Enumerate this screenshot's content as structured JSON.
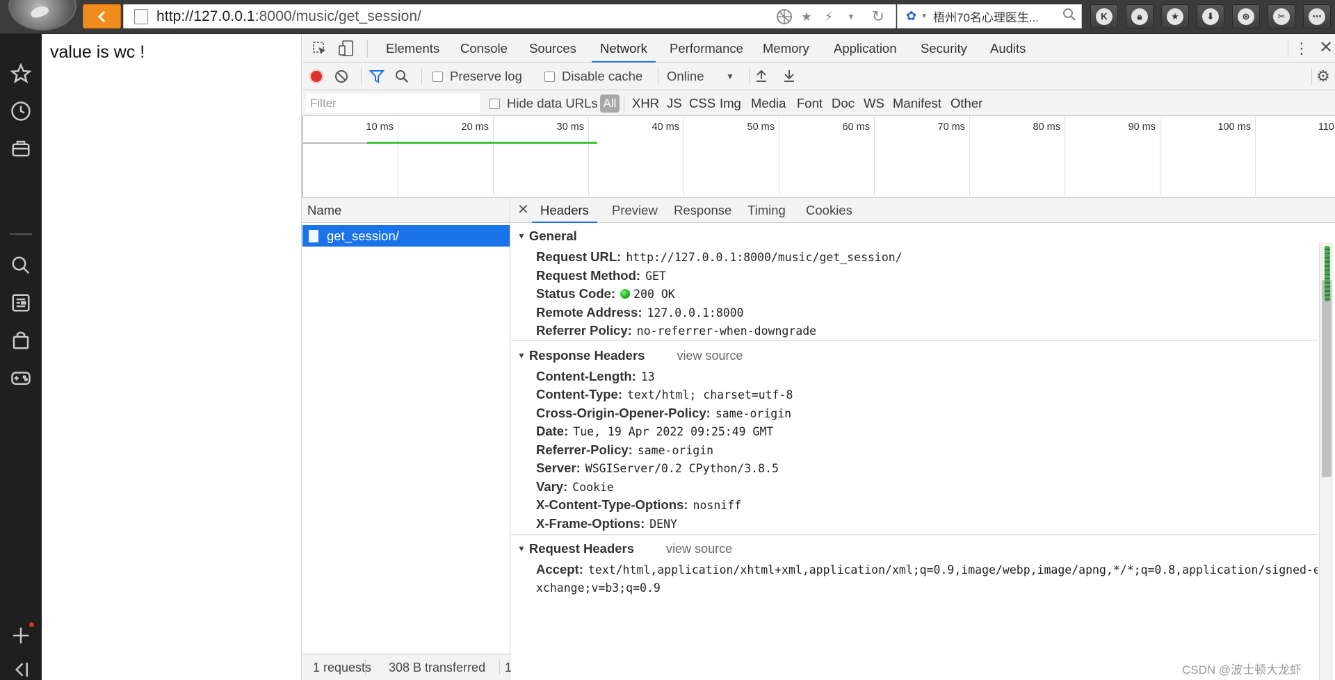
{
  "browser": {
    "url_host": "http://127.0.0.1",
    "url_rest": ":8000/music/get_session/",
    "search_text": "梧州70名心理医生...",
    "toolbar_letter": "K"
  },
  "page": {
    "text": "value is wc !"
  },
  "devtools": {
    "tabs": [
      "Elements",
      "Console",
      "Sources",
      "Network",
      "Performance",
      "Memory",
      "Application",
      "Security",
      "Audits"
    ],
    "active_tab": "Network",
    "toolbar": {
      "preserve_log": "Preserve log",
      "disable_cache": "Disable cache",
      "throttle": "Online"
    },
    "filter": {
      "placeholder": "Filter",
      "hide_data_urls": "Hide data URLs",
      "all": "All",
      "types": [
        "XHR",
        "JS",
        "CSS",
        "Img",
        "Media",
        "Font",
        "Doc",
        "WS",
        "Manifest",
        "Other"
      ]
    },
    "overview_ticks": [
      "10 ms",
      "20 ms",
      "30 ms",
      "40 ms",
      "50 ms",
      "60 ms",
      "70 ms",
      "80 ms",
      "90 ms",
      "100 ms",
      "110"
    ],
    "name_header": "Name",
    "request_name": "get_session/",
    "status_bar": {
      "requests": "1 requests",
      "transferred": "308 B transferred",
      "more": "1"
    },
    "detail_tabs": [
      "Headers",
      "Preview",
      "Response",
      "Timing",
      "Cookies"
    ],
    "general": {
      "title": "General",
      "items": [
        {
          "k": "Request URL:",
          "v": "http://127.0.0.1:8000/music/get_session/"
        },
        {
          "k": "Request Method:",
          "v": "GET"
        },
        {
          "k": "Status Code:",
          "v": "200 OK"
        },
        {
          "k": "Remote Address:",
          "v": "127.0.0.1:8000"
        },
        {
          "k": "Referrer Policy:",
          "v": "no-referrer-when-downgrade"
        }
      ]
    },
    "response_headers": {
      "title": "Response Headers",
      "view_source": "view source",
      "items": [
        {
          "k": "Content-Length:",
          "v": "13"
        },
        {
          "k": "Content-Type:",
          "v": "text/html; charset=utf-8"
        },
        {
          "k": "Cross-Origin-Opener-Policy:",
          "v": "same-origin"
        },
        {
          "k": "Date:",
          "v": "Tue, 19 Apr 2022 09:25:49 GMT"
        },
        {
          "k": "Referrer-Policy:",
          "v": "same-origin"
        },
        {
          "k": "Server:",
          "v": "WSGIServer/0.2 CPython/3.8.5"
        },
        {
          "k": "Vary:",
          "v": "Cookie"
        },
        {
          "k": "X-Content-Type-Options:",
          "v": "nosniff"
        },
        {
          "k": "X-Frame-Options:",
          "v": "DENY"
        }
      ]
    },
    "request_headers": {
      "title": "Request Headers",
      "view_source": "view source",
      "accept_key": "Accept:",
      "accept_value_line1": "text/html,application/xhtml+xml,application/xml;q=0.9,image/webp,image/apng,*/*;q=0.8,application/signed-e",
      "accept_value_line2": "xchange;v=b3;q=0.9"
    }
  },
  "watermark": "CSDN @波士顿大龙虾",
  "colors": {
    "accent": "#1a73e8",
    "back_button": "#f08c1d",
    "record": "#e0302a",
    "status_ok": "#19b219"
  }
}
